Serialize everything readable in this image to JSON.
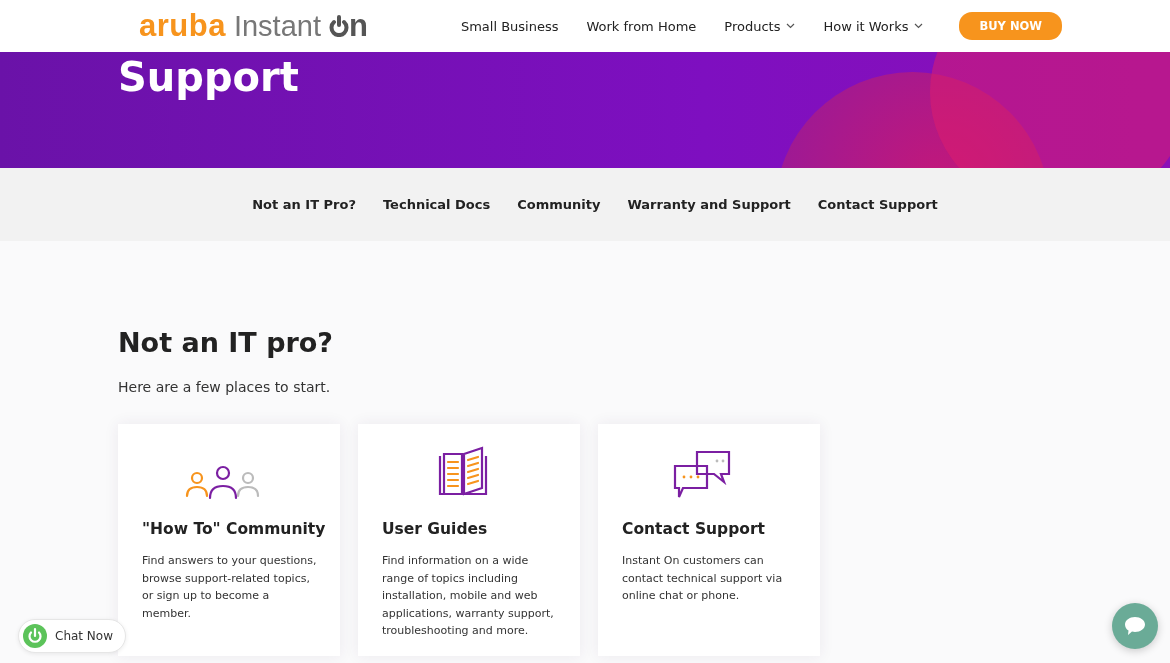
{
  "header": {
    "logo": {
      "brand": "aruba",
      "product": "Instant",
      "suffix": "n"
    },
    "nav": [
      {
        "label": "Small Business",
        "dropdown": false
      },
      {
        "label": "Work from Home",
        "dropdown": false
      },
      {
        "label": "Products",
        "dropdown": true
      },
      {
        "label": "How it Works",
        "dropdown": true
      }
    ],
    "cta": "BUY NOW"
  },
  "hero": {
    "title": "Support"
  },
  "subnav": [
    "Not an IT Pro?",
    "Technical Docs",
    "Community",
    "Warranty and Support",
    "Contact Support"
  ],
  "section": {
    "heading": "Not an IT pro?",
    "intro": "Here are a few places to start.",
    "cards": [
      {
        "kind": "people",
        "title": "\"How To\" Community",
        "text": "Find answers to your questions, browse support-related topics, or sign up to become a member."
      },
      {
        "kind": "book",
        "title": "User Guides",
        "text": "Find information on a wide range of topics including installation, mobile and web applications, warranty support, troubleshooting and more."
      },
      {
        "kind": "chat",
        "title": "Contact Support",
        "text": "Instant On customers can contact technical support via online chat or phone."
      }
    ]
  },
  "chat_button": "Chat Now"
}
